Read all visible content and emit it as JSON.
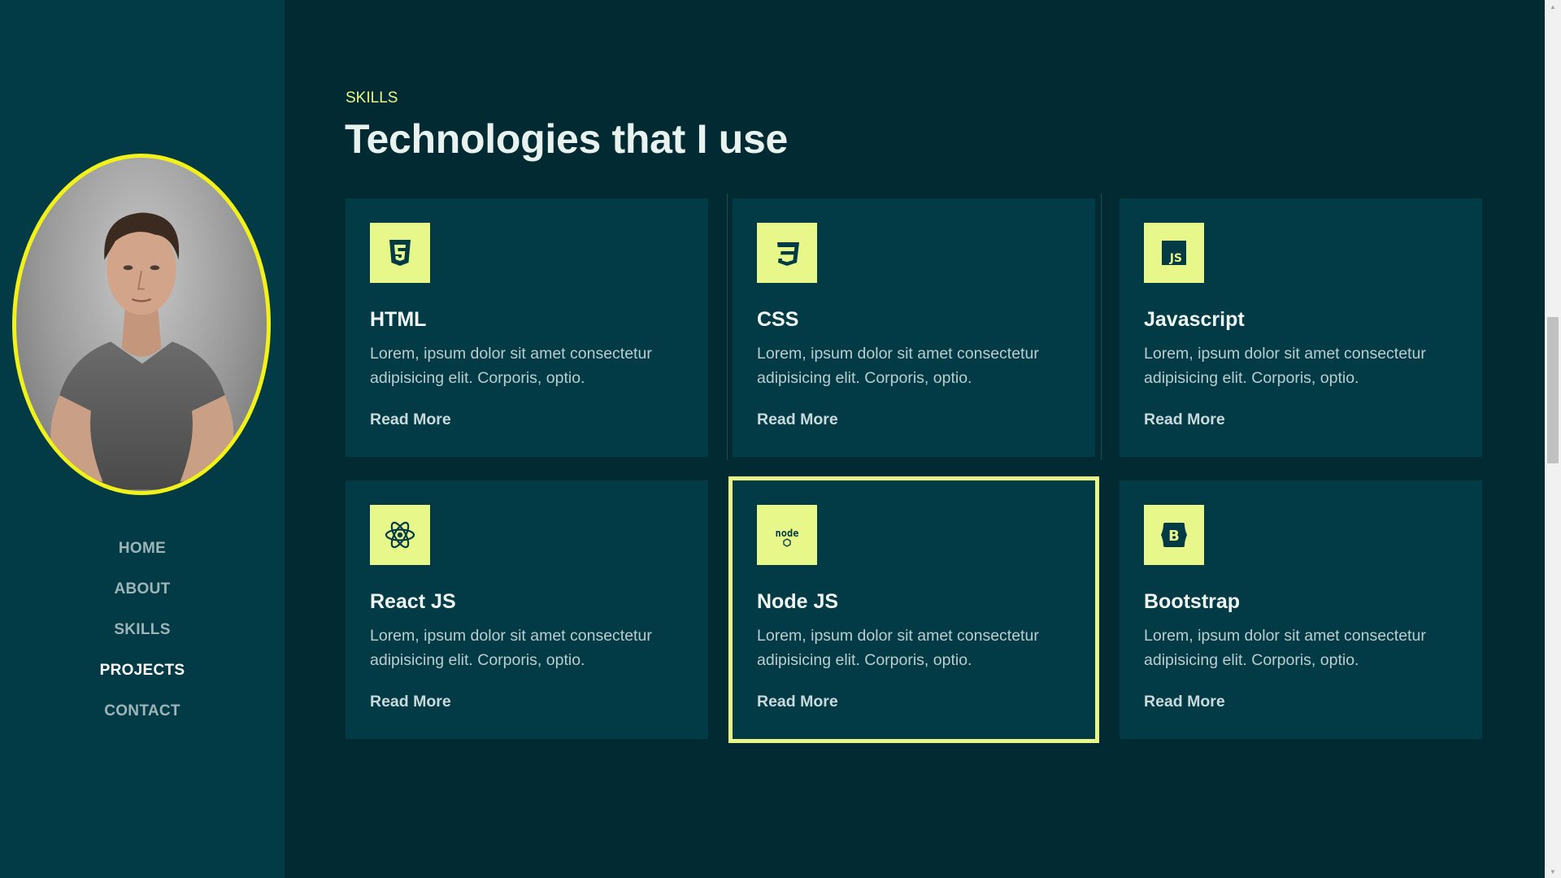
{
  "sidebar": {
    "nav": [
      "HOME",
      "ABOUT",
      "SKILLS",
      "PROJECTS",
      "CONTACT"
    ],
    "active_item": "PROJECTS"
  },
  "section": {
    "eyebrow": "SKILLS",
    "title": "Technologies that I use"
  },
  "cards": [
    {
      "title": "HTML",
      "description": "Lorem, ipsum dolor sit amet consectetur adipisicing elit. Corporis, optio.",
      "link": "Read More",
      "icon": "html5-icon"
    },
    {
      "title": "CSS",
      "description": "Lorem, ipsum dolor sit amet consectetur adipisicing elit. Corporis, optio.",
      "link": "Read More",
      "icon": "css3-icon"
    },
    {
      "title": "Javascript",
      "description": "Lorem, ipsum dolor sit amet consectetur adipisicing elit. Corporis, optio.",
      "link": "Read More",
      "icon": "javascript-icon"
    },
    {
      "title": "React JS",
      "description": "Lorem, ipsum dolor sit amet consectetur adipisicing elit. Corporis, optio.",
      "link": "Read More",
      "icon": "react-icon"
    },
    {
      "title": "Node JS",
      "description": "Lorem, ipsum dolor sit amet consectetur adipisicing elit. Corporis, optio.",
      "link": "Read More",
      "icon": "nodejs-icon"
    },
    {
      "title": "Bootstrap",
      "description": "Lorem, ipsum dolor sit amet consectetur adipisicing elit. Corporis, optio.",
      "link": "Read More",
      "icon": "bootstrap-icon"
    }
  ],
  "highlighted_card": "Node JS",
  "colors": {
    "background": "#022a33",
    "panel": "#023b46",
    "accent": "#e8f78a",
    "avatar_border": "#f2f218"
  }
}
